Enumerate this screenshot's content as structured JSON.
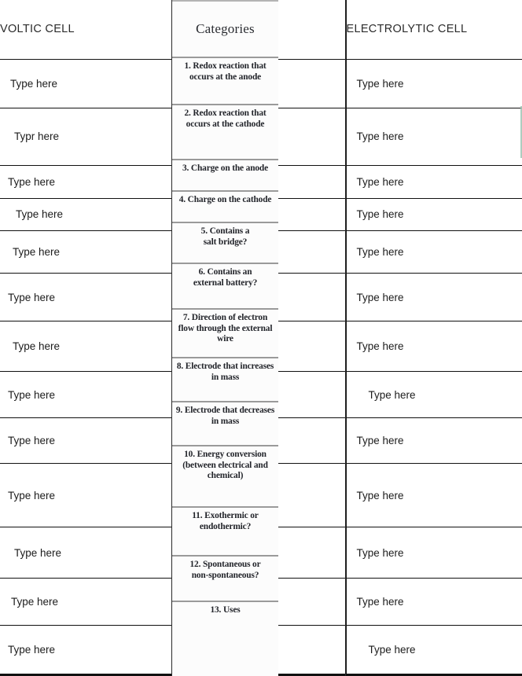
{
  "document": {
    "type": "comparison-worksheet",
    "headers": {
      "left": "VOLTIC CELL",
      "middle": "Categories",
      "right": "ELECTROLYTIC CELL"
    },
    "rows": [
      {
        "n": "1",
        "category": "1. Redox reaction that\noccurs at the anode",
        "left": "Type here",
        "right": "Type here"
      },
      {
        "n": "2",
        "category": "2. Redox reaction that\noccurs at the cathode",
        "left": "Typr here",
        "right": "Type here"
      },
      {
        "n": "3",
        "category": "3. Charge on the anode",
        "left": "Type here",
        "right": "Type here"
      },
      {
        "n": "4",
        "category": "4. Charge on the cathode",
        "left": "Type here",
        "right": "Type here"
      },
      {
        "n": "5",
        "category": "5. Contains a\nsalt bridge?",
        "left": "Type here",
        "right": "Type here"
      },
      {
        "n": "6",
        "category": "6. Contains an\nexternal battery?",
        "left": "Type here",
        "right": "Type here"
      },
      {
        "n": "7",
        "category": "7. Direction of electron\nflow through the external\nwire",
        "left": "Type here",
        "right": "Type here"
      },
      {
        "n": "8",
        "category": "8. Electrode that increases\nin mass",
        "left": "Type here",
        "right": "Type here"
      },
      {
        "n": "9",
        "category": "9. Electrode that decreases\nin mass",
        "left": "Type here",
        "right": "Type here"
      },
      {
        "n": "10",
        "category": "10. Energy conversion\n(between electrical and\nchemical)",
        "left": "Type here",
        "right": "Type here"
      },
      {
        "n": "11",
        "category": "11. Exothermic or\nendothermic?",
        "left": "Type here",
        "right": "Type here"
      },
      {
        "n": "12",
        "category": "12. Spontaneous or\nnon-spontaneous?",
        "left": "Type here",
        "right": "Type here"
      },
      {
        "n": "13",
        "category": "13. Uses",
        "left": "Type here",
        "right": "Type here"
      }
    ]
  },
  "colors": {
    "rule": "#111111",
    "text": "#1c1c1c",
    "scan_text": "#22242a",
    "scan_rule": "#9a9a9a",
    "selection_artifact": "#9fc4b4",
    "page": "#ffffff"
  }
}
